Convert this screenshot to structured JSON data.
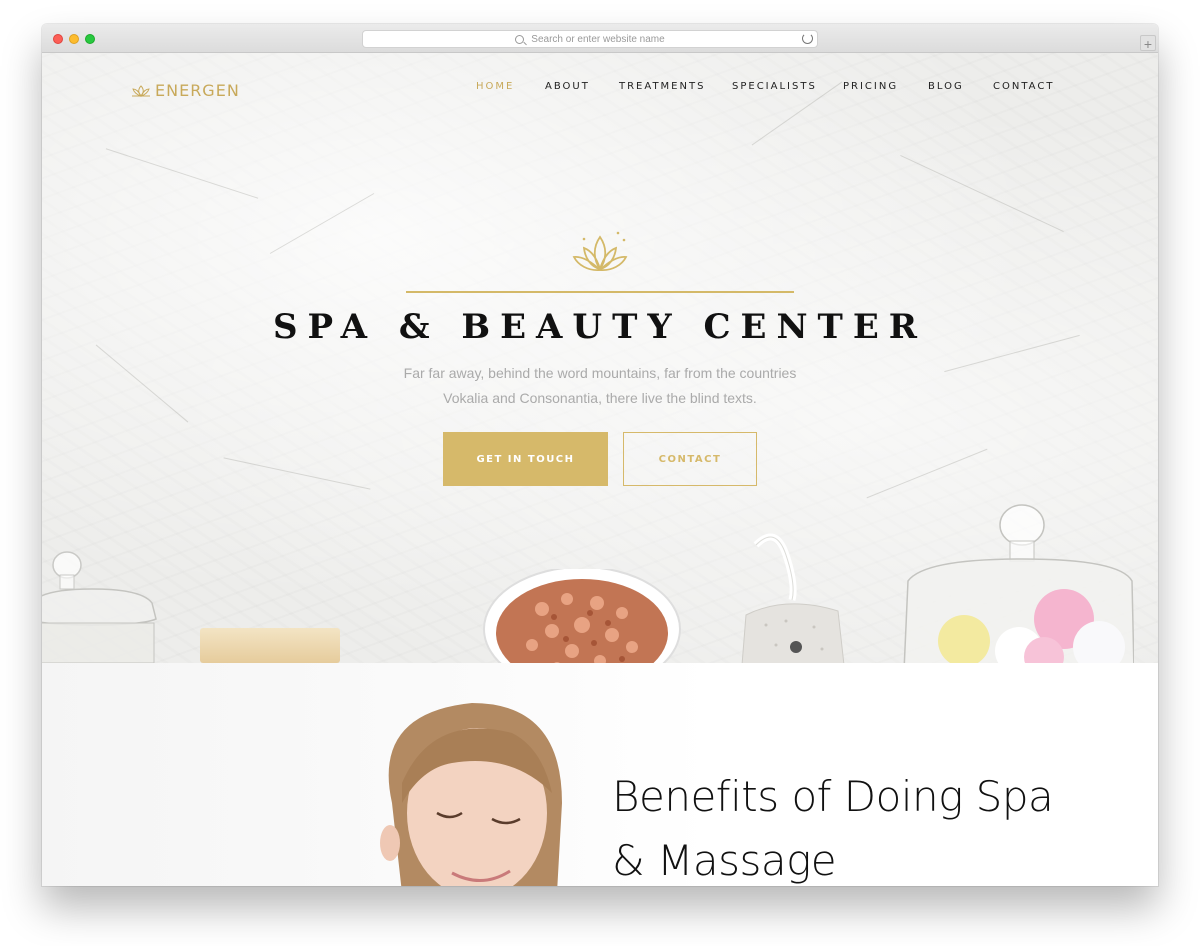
{
  "browser": {
    "address_placeholder": "Search or enter website name",
    "new_tab": "+"
  },
  "site": {
    "logo_text": "ENERGEN",
    "nav": [
      {
        "label": "HOME",
        "active": true
      },
      {
        "label": "ABOUT",
        "active": false
      },
      {
        "label": "TREATMENTS",
        "active": false
      },
      {
        "label": "SPECIALISTS",
        "active": false
      },
      {
        "label": "PRICING",
        "active": false
      },
      {
        "label": "BLOG",
        "active": false
      },
      {
        "label": "CONTACT",
        "active": false
      }
    ]
  },
  "hero": {
    "title": "SPA & BEAUTY CENTER",
    "subtitle_line1": "Far far away, behind the word mountains, far from the countries",
    "subtitle_line2": "Vokalia and Consonantia, there live the blind texts.",
    "primary_button": "GET IN TOUCH",
    "secondary_button": "CONTACT"
  },
  "benefits": {
    "title_line1": "Benefits of Doing Spa",
    "title_line2": "& Massage"
  },
  "colors": {
    "accent_gold": "#d6b96a",
    "text_dark": "#111111",
    "text_muted": "#aaaaaa"
  }
}
